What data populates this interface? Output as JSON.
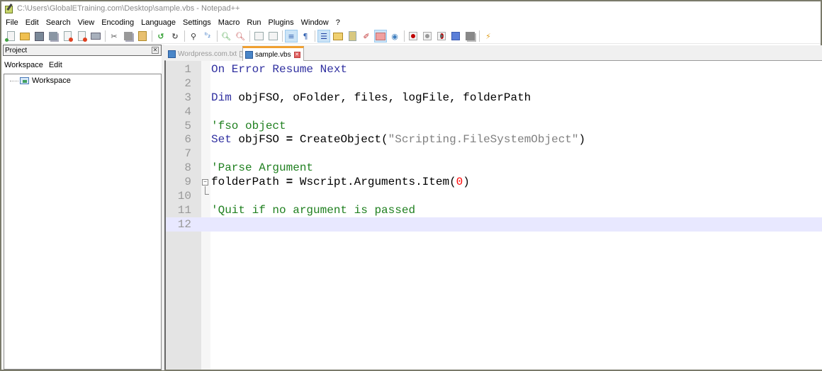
{
  "window": {
    "title": "C:\\Users\\GlobalETraining.com\\Desktop\\sample.vbs - Notepad++"
  },
  "menubar": [
    "File",
    "Edit",
    "Search",
    "View",
    "Encoding",
    "Language",
    "Settings",
    "Macro",
    "Run",
    "Plugins",
    "Window",
    "?"
  ],
  "toolbar": {
    "icons": [
      "new-file-icon",
      "open-file-icon",
      "save-icon",
      "save-all-icon",
      "close-icon",
      "close-all-icon",
      "print-icon",
      "cut-icon",
      "copy-icon",
      "paste-icon",
      "undo-icon",
      "redo-icon",
      "find-icon",
      "replace-icon",
      "zoom-in-icon",
      "zoom-out-icon",
      "sync-vertical-icon",
      "sync-horizontal-icon",
      "word-wrap-icon",
      "show-all-characters-icon",
      "indent-guide-icon",
      "document-map-icon",
      "function-list-icon",
      "folder-as-workspace-icon",
      "project-panel-icon",
      "monitoring-icon",
      "macro-record-icon",
      "macro-stop-icon",
      "macro-play-icon",
      "macro-run-multiple-icon",
      "macro-save-icon",
      "launch-icon"
    ]
  },
  "project_panel": {
    "title": "Project",
    "menu": [
      "Workspace",
      "Edit"
    ],
    "tree": [
      {
        "label": "Workspace"
      }
    ]
  },
  "tabs": [
    {
      "label": "Wordpress.com.txt",
      "active": false
    },
    {
      "label": "sample.vbs",
      "active": true
    }
  ],
  "editor": {
    "current_line": 12,
    "lines": [
      {
        "n": "1",
        "tokens": [
          {
            "t": "On Error Resume Next",
            "c": "kw"
          }
        ]
      },
      {
        "n": "2",
        "tokens": []
      },
      {
        "n": "3",
        "tokens": [
          {
            "t": "Dim",
            "c": "kw"
          },
          {
            "t": " objFSO, oFolder, files, logFile, folderPath",
            "c": ""
          }
        ]
      },
      {
        "n": "4",
        "tokens": []
      },
      {
        "n": "5",
        "tokens": [
          {
            "t": "'fso object",
            "c": "cm"
          }
        ]
      },
      {
        "n": "6",
        "tokens": [
          {
            "t": "Set",
            "c": "kw"
          },
          {
            "t": " objFSO ",
            "c": ""
          },
          {
            "t": "=",
            "c": "op"
          },
          {
            "t": " CreateObject(",
            "c": ""
          },
          {
            "t": "\"Scripting.FileSystemObject\"",
            "c": "str"
          },
          {
            "t": ")",
            "c": ""
          }
        ]
      },
      {
        "n": "7",
        "tokens": []
      },
      {
        "n": "8",
        "tokens": [
          {
            "t": "'Parse Argument",
            "c": "cm"
          }
        ]
      },
      {
        "n": "9",
        "tokens": [
          {
            "t": "folderPath ",
            "c": ""
          },
          {
            "t": "=",
            "c": "op"
          },
          {
            "t": " Wscript.Arguments.Item(",
            "c": ""
          },
          {
            "t": "0",
            "c": "num"
          },
          {
            "t": ")",
            "c": ""
          }
        ],
        "fold": "start"
      },
      {
        "n": "10",
        "tokens": [],
        "fold": "end"
      },
      {
        "n": "11",
        "tokens": [
          {
            "t": "'Quit if no argument is passed",
            "c": "cm"
          }
        ]
      },
      {
        "n": "12",
        "tokens": []
      }
    ]
  }
}
